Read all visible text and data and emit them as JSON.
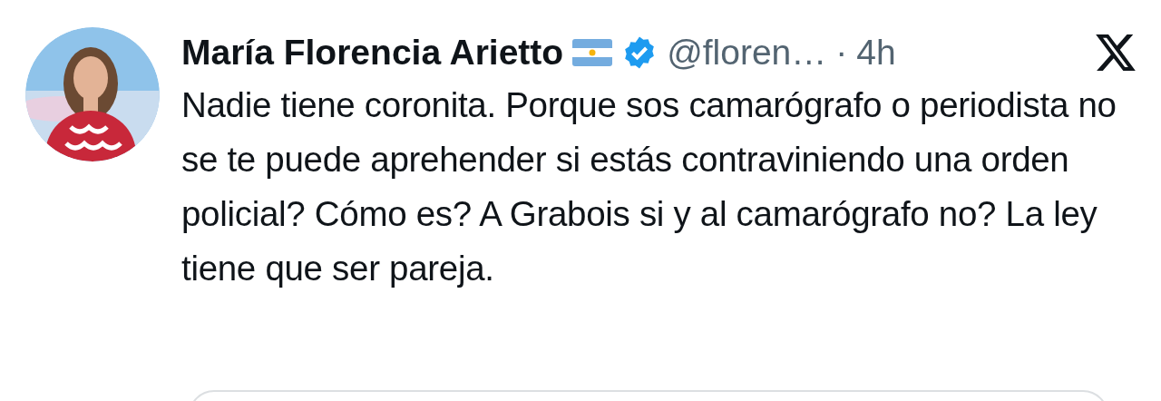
{
  "author": {
    "name": "María Florencia Arietto",
    "verified": true,
    "handle": "@floren…",
    "separator": "·",
    "time": "4h"
  },
  "text": "Nadie tiene coronita. Porque sos camarógrafo o periodista no se te puede aprehender si estás contraviniendo una orden policial? Cómo es? A Grabois si y al camarógrafo no? La ley tiene que ser pareja."
}
